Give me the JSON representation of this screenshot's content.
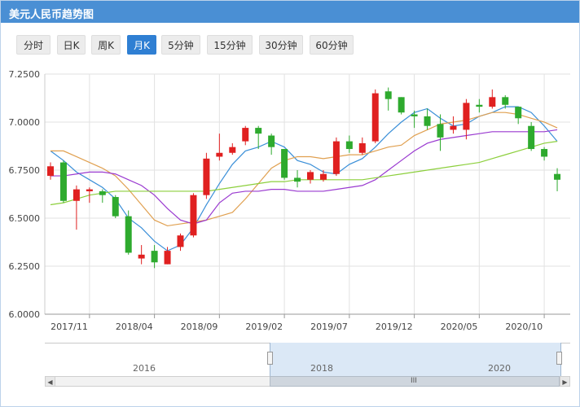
{
  "title": "美元人民币趋势图",
  "tabs": [
    {
      "label": "分时",
      "active": false
    },
    {
      "label": "日K",
      "active": false
    },
    {
      "label": "周K",
      "active": false
    },
    {
      "label": "月K",
      "active": true
    },
    {
      "label": "5分钟",
      "active": false
    },
    {
      "label": "15分钟",
      "active": false
    },
    {
      "label": "30分钟",
      "active": false
    },
    {
      "label": "60分钟",
      "active": false
    }
  ],
  "colors": {
    "header": "#4a8fd4",
    "up": "#e02020",
    "down": "#2eaa2e",
    "ma5": "#3a8fd8",
    "ma10": "#e0a050",
    "ma20": "#9a3ad0",
    "ma60": "#8ccf3c",
    "active_tab": "#2f7fd3"
  },
  "chart_data": {
    "type": "candlestick",
    "y_ticks": [
      "6.0000",
      "6.2500",
      "6.5000",
      "6.7500",
      "7.0000",
      "7.2500"
    ],
    "ylim": [
      6.0,
      7.25
    ],
    "x_tick_labels": [
      {
        "label": "2017/11",
        "index": 3
      },
      {
        "label": "2018/04",
        "index": 8
      },
      {
        "label": "2018/09",
        "index": 13
      },
      {
        "label": "2019/02",
        "index": 18
      },
      {
        "label": "2019/07",
        "index": 23
      },
      {
        "label": "2019/12",
        "index": 28
      },
      {
        "label": "2020/05",
        "index": 33
      },
      {
        "label": "2020/10",
        "index": 38
      }
    ],
    "grid": true,
    "candles": [
      {
        "o": 6.72,
        "c": 6.77,
        "h": 6.79,
        "l": 6.7
      },
      {
        "o": 6.79,
        "c": 6.59,
        "h": 6.8,
        "l": 6.58
      },
      {
        "o": 6.59,
        "c": 6.65,
        "h": 6.67,
        "l": 6.44
      },
      {
        "o": 6.64,
        "c": 6.65,
        "h": 6.66,
        "l": 6.58
      },
      {
        "o": 6.64,
        "c": 6.62,
        "h": 6.65,
        "l": 6.58
      },
      {
        "o": 6.61,
        "c": 6.51,
        "h": 6.62,
        "l": 6.5
      },
      {
        "o": 6.51,
        "c": 6.32,
        "h": 6.54,
        "l": 6.31
      },
      {
        "o": 6.29,
        "c": 6.31,
        "h": 6.36,
        "l": 6.26
      },
      {
        "o": 6.33,
        "c": 6.27,
        "h": 6.36,
        "l": 6.24
      },
      {
        "o": 6.26,
        "c": 6.33,
        "h": 6.35,
        "l": 6.26
      },
      {
        "o": 6.35,
        "c": 6.41,
        "h": 6.42,
        "l": 6.33
      },
      {
        "o": 6.41,
        "c": 6.62,
        "h": 6.63,
        "l": 6.4
      },
      {
        "o": 6.62,
        "c": 6.81,
        "h": 6.84,
        "l": 6.6
      },
      {
        "o": 6.82,
        "c": 6.84,
        "h": 6.94,
        "l": 6.8
      },
      {
        "o": 6.84,
        "c": 6.87,
        "h": 6.89,
        "l": 6.83
      },
      {
        "o": 6.9,
        "c": 6.97,
        "h": 6.98,
        "l": 6.88
      },
      {
        "o": 6.97,
        "c": 6.94,
        "h": 6.98,
        "l": 6.86
      },
      {
        "o": 6.93,
        "c": 6.87,
        "h": 6.94,
        "l": 6.83
      },
      {
        "o": 6.86,
        "c": 6.71,
        "h": 6.86,
        "l": 6.7
      },
      {
        "o": 6.71,
        "c": 6.69,
        "h": 6.75,
        "l": 6.66
      },
      {
        "o": 6.7,
        "c": 6.74,
        "h": 6.75,
        "l": 6.68
      },
      {
        "o": 6.7,
        "c": 6.73,
        "h": 6.75,
        "l": 6.69
      },
      {
        "o": 6.73,
        "c": 6.9,
        "h": 6.92,
        "l": 6.72
      },
      {
        "o": 6.9,
        "c": 6.86,
        "h": 6.93,
        "l": 6.84
      },
      {
        "o": 6.84,
        "c": 6.89,
        "h": 6.92,
        "l": 6.83
      },
      {
        "o": 6.9,
        "c": 7.15,
        "h": 7.17,
        "l": 6.89
      },
      {
        "o": 7.16,
        "c": 7.12,
        "h": 7.18,
        "l": 7.06
      },
      {
        "o": 7.13,
        "c": 7.05,
        "h": 7.13,
        "l": 7.04
      },
      {
        "o": 7.04,
        "c": 7.03,
        "h": 7.06,
        "l": 6.97
      },
      {
        "o": 7.03,
        "c": 6.98,
        "h": 7.07,
        "l": 6.96
      },
      {
        "o": 6.99,
        "c": 6.92,
        "h": 7.04,
        "l": 6.85
      },
      {
        "o": 6.96,
        "c": 6.98,
        "h": 7.03,
        "l": 6.94
      },
      {
        "o": 6.96,
        "c": 7.1,
        "h": 7.12,
        "l": 6.91
      },
      {
        "o": 7.09,
        "c": 7.08,
        "h": 7.12,
        "l": 7.05
      },
      {
        "o": 7.08,
        "c": 7.13,
        "h": 7.17,
        "l": 7.07
      },
      {
        "o": 7.13,
        "c": 7.09,
        "h": 7.14,
        "l": 7.07
      },
      {
        "o": 7.08,
        "c": 7.02,
        "h": 7.08,
        "l": 6.99
      },
      {
        "o": 6.98,
        "c": 6.86,
        "h": 7.0,
        "l": 6.85
      },
      {
        "o": 6.86,
        "c": 6.82,
        "h": 6.87,
        "l": 6.8
      },
      {
        "o": 6.73,
        "c": 6.7,
        "h": 6.76,
        "l": 6.64
      }
    ],
    "series": [
      {
        "values": [
          6.85,
          6.8,
          6.74,
          6.7,
          6.66,
          6.6,
          6.5,
          6.45,
          6.38,
          6.33,
          6.36,
          6.45,
          6.57,
          6.68,
          6.78,
          6.85,
          6.87,
          6.9,
          6.87,
          6.8,
          6.78,
          6.74,
          6.73,
          6.78,
          6.81,
          6.87,
          6.94,
          7.0,
          7.05,
          7.07,
          7.02,
          6.98,
          6.99,
          7.03,
          7.05,
          7.08,
          7.08,
          7.05,
          6.98,
          6.9
        ]
      },
      {
        "values": [
          6.85,
          6.85,
          6.82,
          6.79,
          6.76,
          6.72,
          6.65,
          6.57,
          6.49,
          6.46,
          6.47,
          6.48,
          6.49,
          6.51,
          6.53,
          6.6,
          6.68,
          6.76,
          6.8,
          6.82,
          6.82,
          6.81,
          6.82,
          6.83,
          6.83,
          6.85,
          6.87,
          6.88,
          6.93,
          6.96,
          6.99,
          7.0,
          7.01,
          7.03,
          7.05,
          7.05,
          7.04,
          7.02,
          7.0,
          6.97
        ]
      },
      {
        "values": [
          6.72,
          6.72,
          6.73,
          6.74,
          6.74,
          6.73,
          6.7,
          6.67,
          6.62,
          6.55,
          6.49,
          6.47,
          6.49,
          6.58,
          6.63,
          6.64,
          6.64,
          6.65,
          6.65,
          6.64,
          6.64,
          6.64,
          6.65,
          6.66,
          6.67,
          6.7,
          6.75,
          6.8,
          6.85,
          6.89,
          6.91,
          6.92,
          6.93,
          6.94,
          6.95,
          6.95,
          6.95,
          6.95,
          6.95,
          6.96
        ]
      },
      {
        "values": [
          6.57,
          6.58,
          6.6,
          6.62,
          6.63,
          6.64,
          6.64,
          6.64,
          6.64,
          6.64,
          6.64,
          6.64,
          6.64,
          6.65,
          6.66,
          6.67,
          6.68,
          6.69,
          6.69,
          6.7,
          6.7,
          6.7,
          6.7,
          6.7,
          6.7,
          6.71,
          6.72,
          6.73,
          6.74,
          6.75,
          6.76,
          6.77,
          6.78,
          6.79,
          6.81,
          6.83,
          6.85,
          6.87,
          6.89,
          6.9
        ]
      }
    ]
  },
  "navigator": {
    "labels": [
      "2016",
      "2018",
      "2020"
    ],
    "selection_start": 0.43,
    "selection_end": 0.98
  }
}
